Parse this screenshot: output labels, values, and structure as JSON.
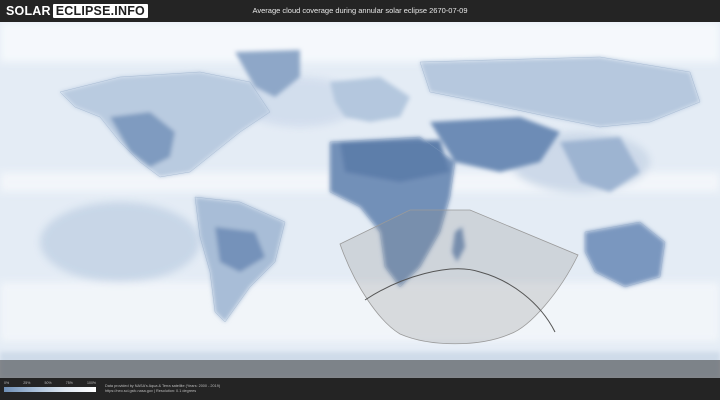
{
  "header": {
    "logo_part1": "SOLAR",
    "logo_part2": "ECLIPSE.INFO",
    "title": "Average cloud coverage during annular solar eclipse 2670-07-09"
  },
  "legend": {
    "labels": [
      "0%",
      "25%",
      "50%",
      "75%",
      "100%"
    ],
    "colors": [
      "#6f8fb5",
      "#a9bfd8",
      "#dfe8f2",
      "#ffffff"
    ]
  },
  "credits": {
    "line1": "Data provided by NASA's Aqua & Terra satellite (Years: 2000 - 2019)",
    "line2": "https://neo.sci.gsfc.nasa.gov | Resolution: 0.1 degrees"
  },
  "map": {
    "colors": {
      "ocean_cloud": "#e9f0f7",
      "land_cloud_low": "#5f7fa8",
      "land_cloud_mid": "#9fb6d2",
      "eclipse_zone": "#8a8a8a"
    }
  }
}
